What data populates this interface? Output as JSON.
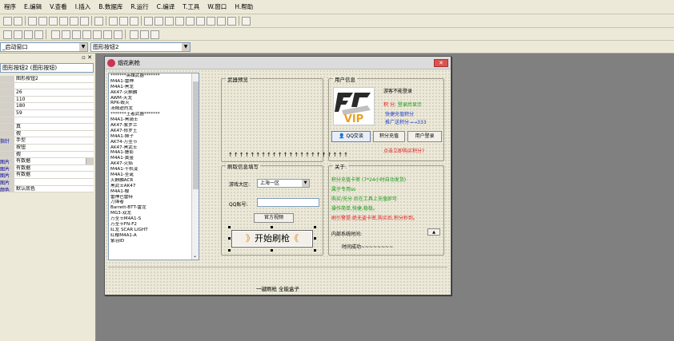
{
  "menu": [
    "程序",
    "E.编辑",
    "V.查看",
    "I.插入",
    "B.数据库",
    "R.运行",
    "C.编译",
    "T.工具",
    "W.窗口",
    "H.帮助"
  ],
  "toolbar3": {
    "window_combo": "_启动窗口",
    "control_combo": "图形按钮2"
  },
  "left_panel": {
    "component_combo": "图形按钮2 (图形按钮)",
    "properties": [
      {
        "name": "",
        "value": "图形按钮2"
      },
      {
        "name": "",
        "value": ""
      },
      {
        "name": "",
        "value": "26"
      },
      {
        "name": "",
        "value": "110"
      },
      {
        "name": "",
        "value": "180"
      },
      {
        "name": "",
        "value": "59"
      },
      {
        "name": "",
        "value": ""
      },
      {
        "name": "",
        "value": "真"
      },
      {
        "name": "",
        "value": "假"
      },
      {
        "name": "指针",
        "value": "手型"
      },
      {
        "name": "",
        "value": "按钮"
      },
      {
        "name": "",
        "value": "假"
      },
      {
        "name": "图片",
        "value": "有数据"
      },
      {
        "name": "图片",
        "value": "有数据"
      },
      {
        "name": "图片",
        "value": "有数据"
      },
      {
        "name": "图片",
        "value": ""
      },
      {
        "name": "颜色",
        "value": "默认底色"
      }
    ]
  },
  "form": {
    "title": "烟花刷枪",
    "weapons": [
      "*******英雄武器*******",
      "M4A1-雷神",
      "M4A1-黑龙",
      "AK47-火麒麟",
      "AWM-天龙",
      "RPK-毁灭",
      "汤姆逊烈龙",
      "*******王者武器*******",
      "M4A1-黑骑士",
      "AK47-紫罗兰",
      "AK47-修罗王",
      "M4A1-狮子",
      "AK74-万圣节",
      "AK47-黑武士",
      "M4A1-魅影",
      "M4A1-黄金",
      "AK47-火焰",
      "M4A1-千机变",
      "M4A1-圣诞",
      "火麒麟ACR",
      "黑武士AK47",
      "M4A1-樱",
      "雷神巴雷特",
      "刀锋者",
      "Barrett-BTT-雷龙",
      "MG3-双龙",
      "万圣节M4A1-S",
      "万圣节FN-F2",
      "红龙 SCAR LIGHT",
      "红樱M4A1-A",
      "紫羽ID"
    ],
    "preview": {
      "caption": "武器预览",
      "arrows": "↑↑↑↑↑↑↑↑↑↑↑↑↑↑↑↑↑↑↑↑↑↑"
    },
    "fill": {
      "caption": "刷取信息填写",
      "server_label": "游戏大区:",
      "server_value": "上海一区",
      "qq_label": "QQ账号:",
      "qq_value": "",
      "video_button": "官方视频",
      "start_button": "开始刷枪"
    },
    "user": {
      "caption": "用户信息",
      "vip_text": "VIP",
      "greeting": "游客不能登录",
      "points_label": "积 分:",
      "points_value": "登录后显示",
      "recharge": "快捷充值积分",
      "promo": "推广送积分→→333",
      "qq_button": "QQ交谈",
      "recharge_button": "积分充值",
      "login_button": "用户登录",
      "buy_link": "点击立即购买积分?"
    },
    "about": {
      "caption": "关于:",
      "line1": "积分充值卡密 (7*24小时自动发货)",
      "line2": "属于专用ss",
      "line3": "购买/充分 后在工具上充值即可",
      "line4": "操作简单,快捷,稳稳。",
      "line5": "刷引警提:绝无盗卡密,购买后,积分秒到。",
      "time_label": "内部系统时间:",
      "time_value": "时间成功~~~~~~~~"
    },
    "bottom_text": "一键刷枪 全能盒子"
  },
  "colors": {
    "menu_bg": "#ece9d8",
    "workspace": "#808080",
    "green_text": "#1a9a1a",
    "red_text": "#e02020",
    "blue_text": "#2040d0"
  }
}
